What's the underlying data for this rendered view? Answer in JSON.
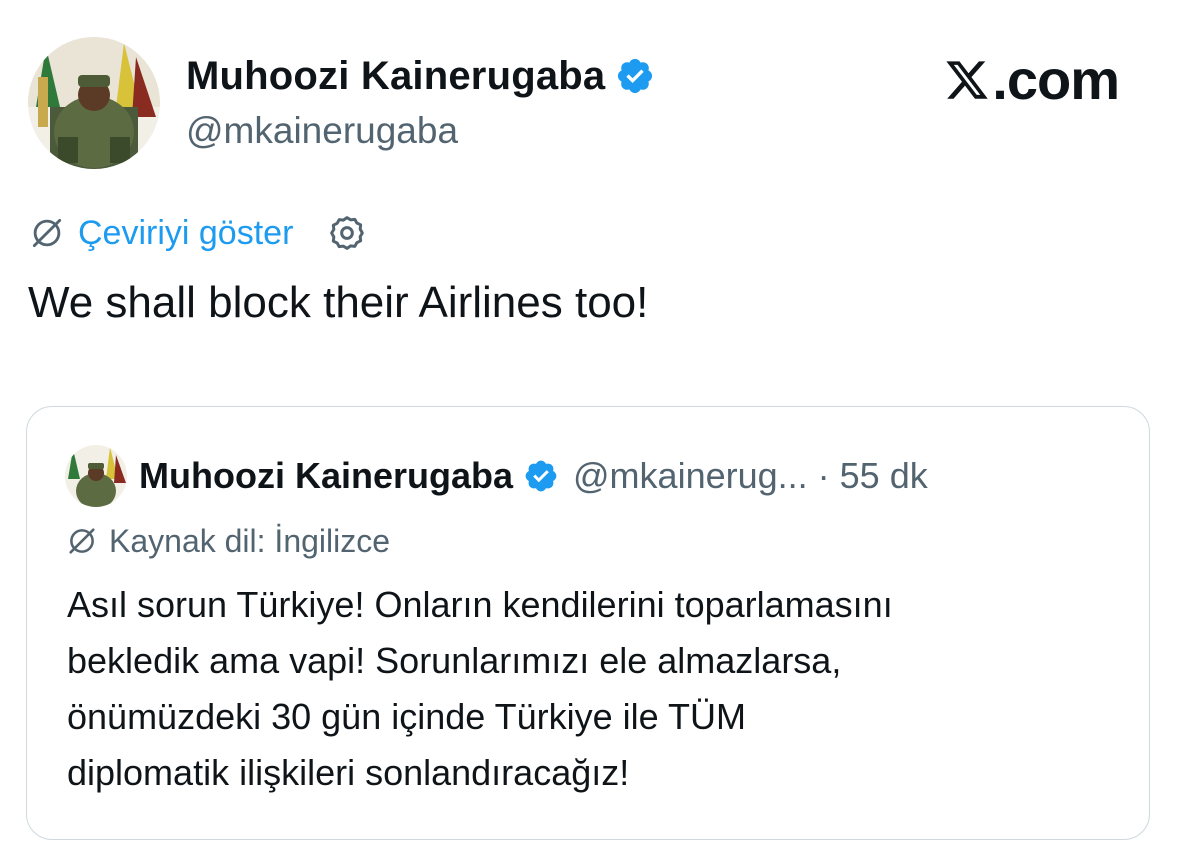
{
  "author": {
    "display_name": "Muhoozi Kainerugaba",
    "handle": "@mkainerugaba",
    "verified_icon": "verified-badge-icon",
    "avatar": "profile-photo"
  },
  "brand": {
    "text": ".com",
    "logo": "x-logo-icon"
  },
  "translation": {
    "link_label": "Çeviriyi göster",
    "icon": "translate-off-icon",
    "settings_icon": "gear-icon"
  },
  "tweet": {
    "text": "We shall block their Airlines too!"
  },
  "quoted_tweet": {
    "display_name": "Muhoozi Kainerugaba",
    "handle": "@mkainerug...",
    "separator": "·",
    "time": "55 dk",
    "source_label": "Kaynak dil: İngilizce",
    "lines": [
      "Asıl sorun Türkiye! Onların kendilerini toparlamasını",
      "bekledik ama vapi! Sorunlarımızı ele almazlarsa,",
      "önümüzdeki 30 gün içinde Türkiye ile TÜM",
      "diplomatik ilişkileri sonlandıracağız!"
    ]
  },
  "colors": {
    "link": "#1d9bf0",
    "secondary_text": "#536471",
    "border": "#cfd9de",
    "verified": "#1d9bf0"
  }
}
